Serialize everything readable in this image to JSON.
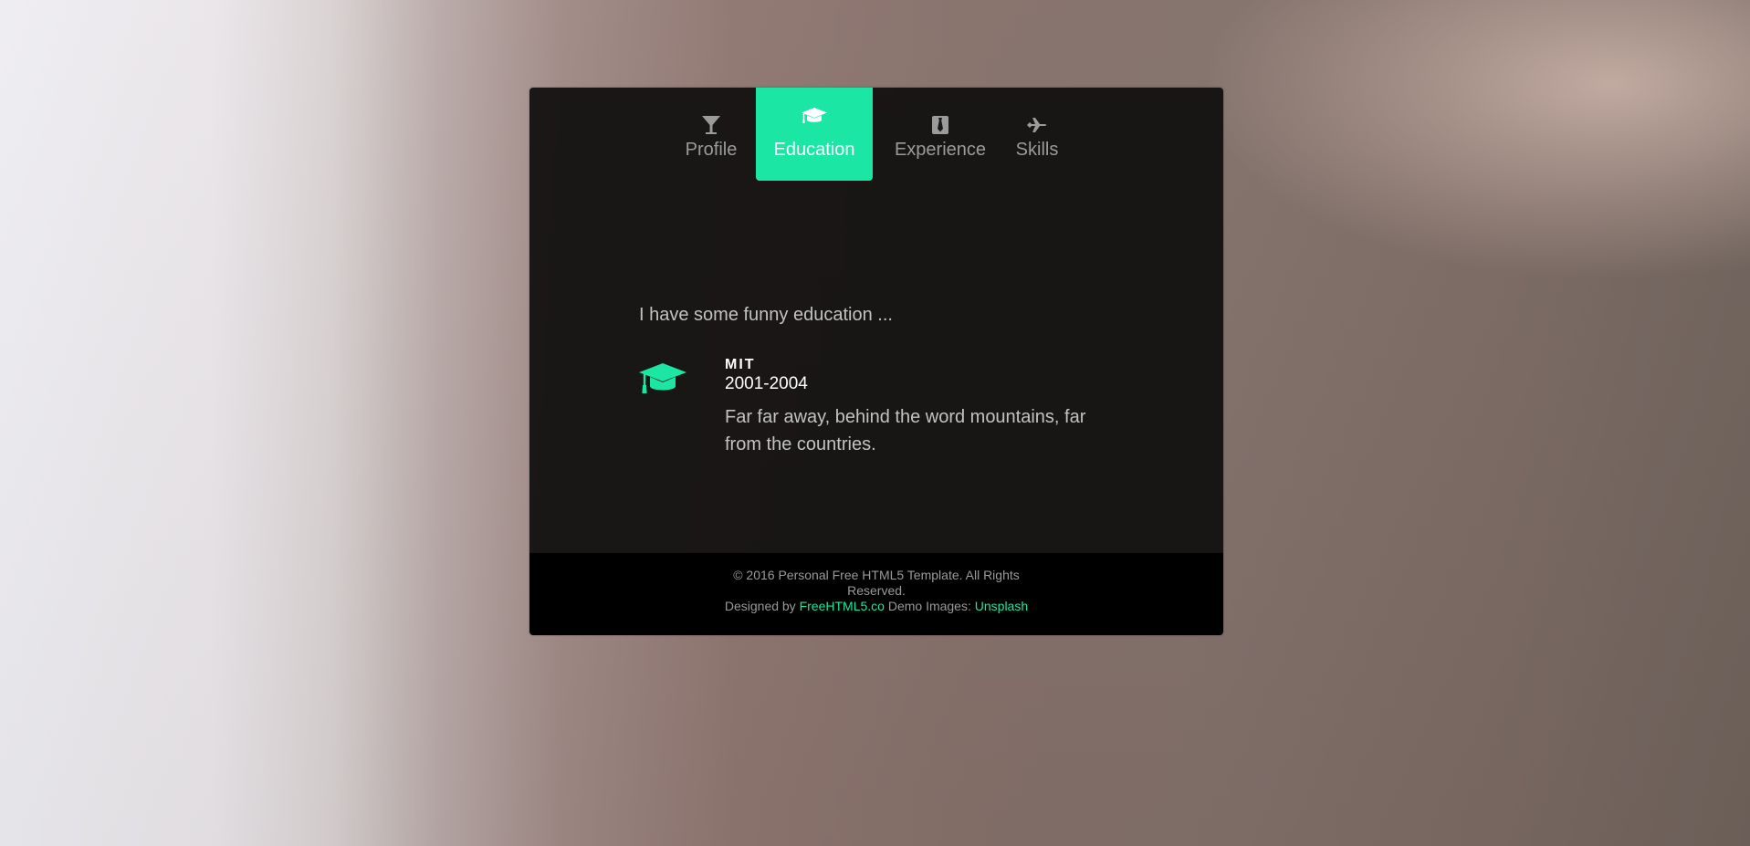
{
  "tabs": [
    {
      "label": "Profile",
      "icon": "cocktail-glass-icon",
      "active": false
    },
    {
      "label": "Education",
      "icon": "graduation-cap-icon",
      "active": true
    },
    {
      "label": "Experience",
      "icon": "necktie-icon",
      "active": false
    },
    {
      "label": "Skills",
      "icon": "airplane-icon",
      "active": false
    }
  ],
  "education": {
    "intro": "I have some funny education ...",
    "entries": [
      {
        "school": "MIT",
        "years": "2001-2004",
        "description": "Far far away, behind the word mountains, far from the countries.",
        "icon": "graduation-cap-icon"
      }
    ]
  },
  "footer": {
    "copyright": "© 2016 Personal Free HTML5 Template. All Rights Reserved.",
    "designed_by_label": "Designed by",
    "designed_by_link": "FreeHTML5.co",
    "images_label": "Demo Images:",
    "images_link": "Unsplash"
  },
  "colors": {
    "accent": "#1ce6a4",
    "card_background": "#141212",
    "footer_background": "#000000",
    "muted_text": "#9b9b9b"
  }
}
